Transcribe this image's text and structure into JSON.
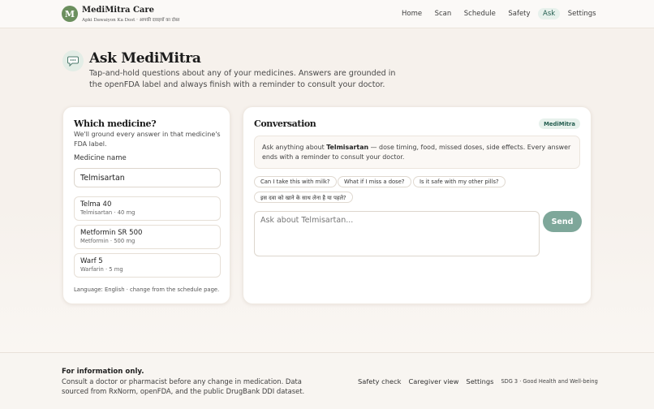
{
  "header": {
    "logo_letter": "M",
    "brand_name": "MediMitra Care",
    "brand_tagline": "Apki Dawaiyon Ka Dost · आपकी दवाइयों का दोस्त",
    "nav": [
      "Home",
      "Scan",
      "Schedule",
      "Safety",
      "Ask",
      "Settings"
    ],
    "active_nav": "Ask"
  },
  "hero": {
    "icon": "chat-bubble-icon",
    "title": "Ask MediMitra",
    "subtitle": "Tap-and-hold questions about any of your medicines. Answers are grounded in the openFDA label and always finish with a reminder to consult your doctor."
  },
  "medicine_panel": {
    "title": "Which medicine?",
    "description": "We'll ground every answer in that medicine's FDA label.",
    "input_label": "Medicine name",
    "input_value": "Telmisartan",
    "options": [
      {
        "name": "Telma 40",
        "detail": "Telmisartan · 40 mg"
      },
      {
        "name": "Metformin SR 500",
        "detail": "Metformin · 500 mg"
      },
      {
        "name": "Warf 5",
        "detail": "Warfarin · 5 mg"
      }
    ],
    "footer_note": "Language: English · change from the schedule page."
  },
  "conversation": {
    "title": "Conversation",
    "badge": "MediMitra",
    "message_prefix": "Ask anything about",
    "message_drug": "Telmisartan",
    "message_rest": "— dose timing, food, missed doses, side effects. Every answer ends with a reminder to consult your doctor.",
    "chips": [
      "Can I take this with milk?",
      "What if I miss a dose?",
      "Is it safe with my other pills?",
      "इस दवा को खाने के साथ लेना है या पहले?"
    ],
    "input_placeholder": "Ask about Telmisartan...",
    "send_label": "Send"
  },
  "footer": {
    "heading": "For information only.",
    "text": "Consult a doctor or pharmacist before any change in medication. Data sourced from RxNorm, openFDA, and the public DrugBank DDI dataset.",
    "links": [
      "Safety check",
      "Caregiver view",
      "Settings"
    ],
    "sdg": "SDG 3 · Good Health and Well-being"
  },
  "colors": {
    "accent": "#245e50",
    "accent_soft": "#e7f1ec",
    "send_button": "#7ea79a",
    "logo": "#6b8f5e",
    "background": "#f6f1ec"
  }
}
